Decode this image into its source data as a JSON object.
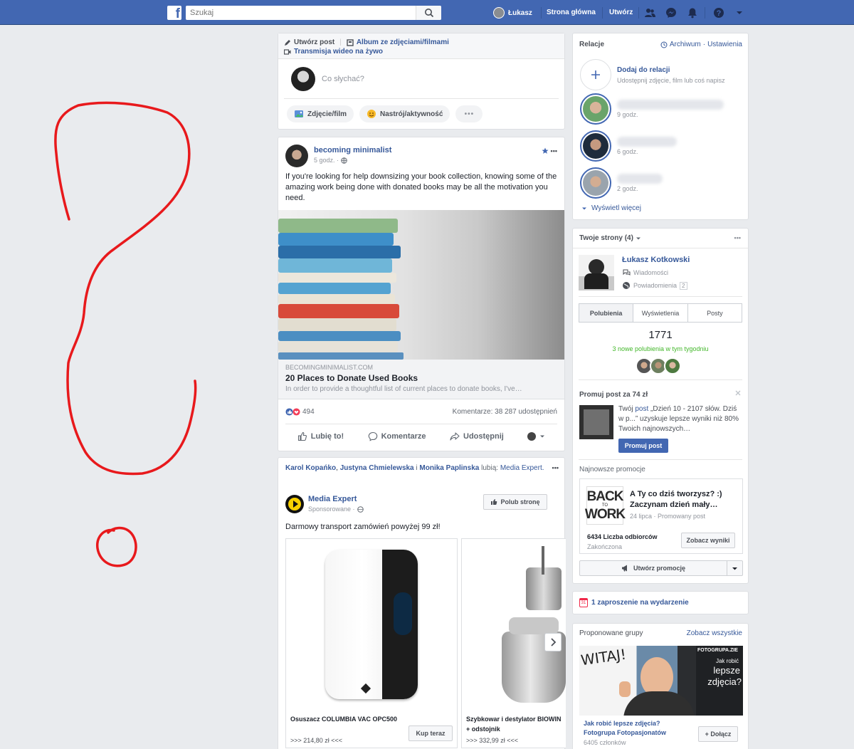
{
  "topbar": {
    "search_placeholder": "Szukaj",
    "user_name": "Łukasz",
    "home": "Strona główna",
    "create": "Utwórz"
  },
  "composer": {
    "create_post": "Utwórz post",
    "album": "Album ze zdjęciami/filmami",
    "live": "Transmisja wideo na żywo",
    "placeholder": "Co słychać?",
    "photo_btn": "Zdjęcie/film",
    "feeling_btn": "Nastrój/aktywność"
  },
  "post": {
    "author": "becoming minimalist",
    "time": "5 godz. ·",
    "text": "If you're looking for help downsizing your book collection, knowing some of the amazing work being done with donated books may be all the motivation you need.",
    "link_domain": "BECOMINGMINIMALIST.COM",
    "link_title": "20 Places to Donate Used Books",
    "link_desc": "In order to provide a thoughtful list of current places to donate books, I've…",
    "reactions": "494",
    "counts": "Komentarze: 38   287 udostępnień",
    "like": "Lubię to!",
    "comment": "Komentarze",
    "share": "Udostępnij"
  },
  "ad": {
    "liked_by": {
      "person1": "Karol Kopańko",
      "sep1": ",",
      "person2": "Justyna Chmielewska",
      "and": "i",
      "person3": "Monika Paplinska",
      "likes": "lubią:",
      "page": "Media Expert."
    },
    "advertiser": "Media Expert",
    "sponsored": "Sponsorowane ·",
    "like_page": "Polub stronę",
    "text": "Darmowy transport zamówień powyżej 99 zł!",
    "products": [
      {
        "name": "Osuszacz COLUMBIA VAC OPC500",
        "price": ">>> 214,80 zł <<<",
        "cta": "Kup teraz"
      },
      {
        "name": "Szybkowar i destylator BIOWIN",
        "name2": "+ odstojnik",
        "price": ">>> 332,99 zł <<<"
      }
    ]
  },
  "stories": {
    "title": "Relacje",
    "archive": "Archiwum",
    "dot": "·",
    "settings": "Ustawienia",
    "add_title": "Dodaj do relacji",
    "add_sub": "Udostępnij zdjęcie, film lub coś napisz",
    "items": [
      {
        "time": "9 godz."
      },
      {
        "time": "6 godz."
      },
      {
        "time": "2 godz."
      }
    ],
    "see_more": "Wyświetl więcej"
  },
  "pages": {
    "title": "Twoje strony (4)",
    "name": "Łukasz Kotkowski",
    "messages": "Wiadomości",
    "notifications": "Powiadomienia",
    "notif_count": "2",
    "tabs": [
      "Polubienia",
      "Wyświetlenia",
      "Posty"
    ],
    "likes": "1771",
    "new_likes": "3 nowe polubienia w tym tygodniu",
    "promote_title": "Promuj post za 74 zł",
    "promote_text_prefix": "Twój",
    "promote_post_link": "post",
    "promote_text": "„Dzień 10 - 2107 słów. Dziś w p...” uzyskuje lepsze wyniki niż 80% Twoich najnowszych…",
    "promote_btn": "Promuj post",
    "recent_title": "Najnowsze promocje",
    "promo_img_text": "BACK TO WORK",
    "promo_img_word1": "BACK",
    "promo_img_word2": "TO",
    "promo_img_word3": "WORK",
    "promo_heading": "A Ty co dziś tworzysz? :) Zaczynam dzień mały…",
    "promo_meta": "24 lipca · Promowany post",
    "promo_reach": "6434 Liczba odbiorców",
    "promo_status": "Zakończona",
    "see_results": "Zobacz wyniki",
    "create_promo": "Utwórz promocję"
  },
  "event": {
    "text": "1 zaproszenie na wydarzenie",
    "icon_day": "31"
  },
  "groups": {
    "title": "Proponowane grupy",
    "see_all": "Zobacz wszystkie",
    "img_brand": "FOTOGRUPA.ZIE",
    "img_line1": "Jak robić",
    "img_line2": "lepsze",
    "img_line3": "zdjęcia?",
    "img_scribble": "WITAJ!",
    "name": "Jak robić lepsze zdjęcia? Fotogrupa Fotopasjonatów",
    "members": "6405 członków",
    "join": "+ Dołącz"
  },
  "colors": {
    "brand": "#4267b2",
    "link": "#365899",
    "annotation": "#e8191c",
    "green": "#42b72a"
  }
}
